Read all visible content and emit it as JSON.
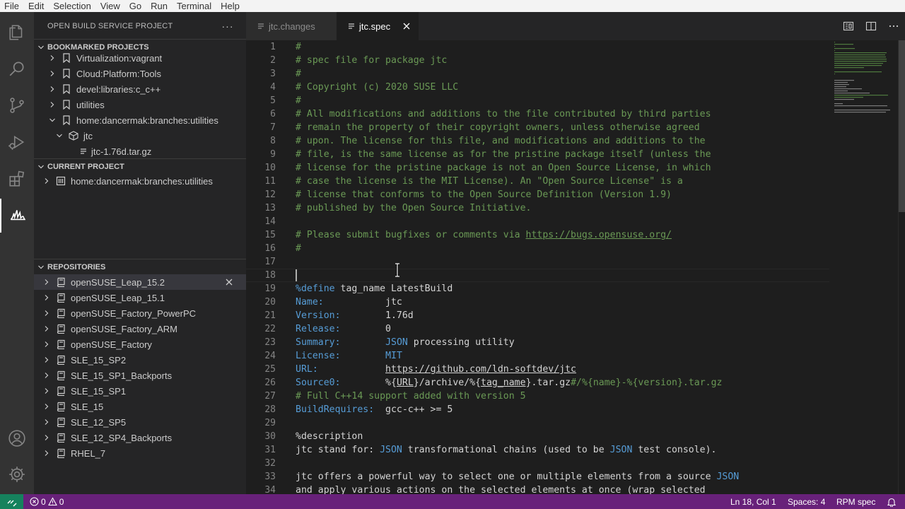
{
  "menu": [
    "File",
    "Edit",
    "Selection",
    "View",
    "Go",
    "Run",
    "Terminal",
    "Help"
  ],
  "activity_bar": {
    "top": [
      "files-icon",
      "search-icon",
      "source-control-icon",
      "run-debug-icon",
      "extensions-icon",
      "open-build-service-icon"
    ],
    "bottom": [
      "account-icon",
      "settings-gear-icon"
    ],
    "active": "open-build-service-icon"
  },
  "sidebar": {
    "title": "OPEN BUILD SERVICE PROJECT",
    "more_label": "···",
    "bookmarked": {
      "header": "BOOKMARKED PROJECTS",
      "items": [
        {
          "label": "Virtualization:vagrant",
          "expanded": false,
          "indent": 1,
          "icon": "bookmark-icon"
        },
        {
          "label": "Cloud:Platform:Tools",
          "expanded": false,
          "indent": 1,
          "icon": "bookmark-icon"
        },
        {
          "label": "devel:libraries:c_c++",
          "expanded": false,
          "indent": 1,
          "icon": "bookmark-icon"
        },
        {
          "label": "utilities",
          "expanded": false,
          "indent": 1,
          "icon": "bookmark-icon"
        },
        {
          "label": "home:dancermak:branches:utilities",
          "expanded": true,
          "indent": 1,
          "icon": "bookmark-icon"
        },
        {
          "label": "jtc",
          "expanded": true,
          "indent": 2,
          "icon": "package-icon"
        },
        {
          "label": "jtc-1.76d.tar.gz",
          "expanded": null,
          "indent": 3,
          "icon": "file-icon"
        }
      ]
    },
    "current": {
      "header": "CURRENT PROJECT",
      "items": [
        {
          "label": "home:dancermak:branches:utilities",
          "icon": "project-icon"
        }
      ]
    },
    "repositories": {
      "header": "REPOSITORIES",
      "items": [
        "openSUSE_Leap_15.2",
        "openSUSE_Leap_15.1",
        "openSUSE_Factory_PowerPC",
        "openSUSE_Factory_ARM",
        "openSUSE_Factory",
        "SLE_15_SP2",
        "SLE_15_SP1_Backports",
        "SLE_15_SP1",
        "SLE_15",
        "SLE_12_SP5",
        "SLE_12_SP4_Backports",
        "RHEL_7"
      ],
      "selected": "openSUSE_Leap_15.2"
    }
  },
  "tabs": [
    {
      "label": "jtc.changes",
      "active": false
    },
    {
      "label": "jtc.spec",
      "active": true
    }
  ],
  "editor": {
    "lines": [
      [
        {
          "t": "#",
          "c": "com"
        }
      ],
      [
        {
          "t": "# spec file for package jtc",
          "c": "com"
        }
      ],
      [
        {
          "t": "#",
          "c": "com"
        }
      ],
      [
        {
          "t": "# Copyright (c) 2020 SUSE LLC",
          "c": "com"
        }
      ],
      [
        {
          "t": "#",
          "c": "com"
        }
      ],
      [
        {
          "t": "# All modifications and additions to the file contributed by third parties",
          "c": "com"
        }
      ],
      [
        {
          "t": "# remain the property of their copyright owners, unless otherwise agreed",
          "c": "com"
        }
      ],
      [
        {
          "t": "# upon. The license for this file, and modifications and additions to the",
          "c": "com"
        }
      ],
      [
        {
          "t": "# file, is the same license as for the pristine package itself (unless the",
          "c": "com"
        }
      ],
      [
        {
          "t": "# license for the pristine package is not an Open Source License, in which",
          "c": "com"
        }
      ],
      [
        {
          "t": "# case the license is the MIT License). An \"Open Source License\" is a",
          "c": "com"
        }
      ],
      [
        {
          "t": "# license that conforms to the Open Source Definition (Version 1.9)",
          "c": "com"
        }
      ],
      [
        {
          "t": "# published by the Open Source Initiative.",
          "c": "com"
        }
      ],
      [],
      [
        {
          "t": "# Please submit bugfixes or comments via ",
          "c": "com"
        },
        {
          "t": "https://bugs.opensuse.org/",
          "c": "com link"
        }
      ],
      [
        {
          "t": "#",
          "c": "com"
        }
      ],
      [],
      [],
      [
        {
          "t": "%define",
          "c": "key"
        },
        {
          "t": " tag_name LatestBuild",
          "c": ""
        }
      ],
      [
        {
          "t": "Name:",
          "c": "key"
        },
        {
          "t": "           jtc",
          "c": ""
        }
      ],
      [
        {
          "t": "Version:",
          "c": "key"
        },
        {
          "t": "        1.76d",
          "c": ""
        }
      ],
      [
        {
          "t": "Release:",
          "c": "key"
        },
        {
          "t": "        0",
          "c": ""
        }
      ],
      [
        {
          "t": "Summary:",
          "c": "key"
        },
        {
          "t": "        ",
          "c": ""
        },
        {
          "t": "JSON",
          "c": "key"
        },
        {
          "t": " processing utility",
          "c": ""
        }
      ],
      [
        {
          "t": "License:",
          "c": "key"
        },
        {
          "t": "        ",
          "c": ""
        },
        {
          "t": "MIT",
          "c": "key"
        }
      ],
      [
        {
          "t": "URL:",
          "c": "key"
        },
        {
          "t": "            ",
          "c": ""
        },
        {
          "t": "https://github.com/ldn-softdev/jtc",
          "c": "link"
        }
      ],
      [
        {
          "t": "Source0:",
          "c": "key"
        },
        {
          "t": "        %{",
          "c": ""
        },
        {
          "t": "URL",
          "c": "link"
        },
        {
          "t": "}/archive/%{",
          "c": ""
        },
        {
          "t": "tag_name",
          "c": "link"
        },
        {
          "t": "}.tar.gz",
          "c": ""
        },
        {
          "t": "#/%{name}-%{version}.tar.gz",
          "c": "com"
        }
      ],
      [
        {
          "t": "# Full C++14 support added with version 5",
          "c": "com"
        }
      ],
      [
        {
          "t": "BuildRequires:",
          "c": "key"
        },
        {
          "t": "  gcc-c++ >= 5",
          "c": ""
        }
      ],
      [],
      [
        {
          "t": "%description",
          "c": ""
        }
      ],
      [
        {
          "t": "jtc stand for: ",
          "c": ""
        },
        {
          "t": "JSON",
          "c": "key"
        },
        {
          "t": " transformational chains (used to be ",
          "c": ""
        },
        {
          "t": "JSON",
          "c": "key"
        },
        {
          "t": " test console).",
          "c": ""
        }
      ],
      [],
      [
        {
          "t": "jtc offers a powerful way to select one or multiple elements from a source ",
          "c": ""
        },
        {
          "t": "JSON",
          "c": "key"
        }
      ],
      [
        {
          "t": "and apply various actions on the selected elements at once (wrap selected",
          "c": ""
        }
      ]
    ]
  },
  "status": {
    "errors": "0",
    "warnings": "0",
    "position": "Ln 18, Col 1",
    "spaces": "Spaces: 4",
    "language": "RPM spec"
  }
}
